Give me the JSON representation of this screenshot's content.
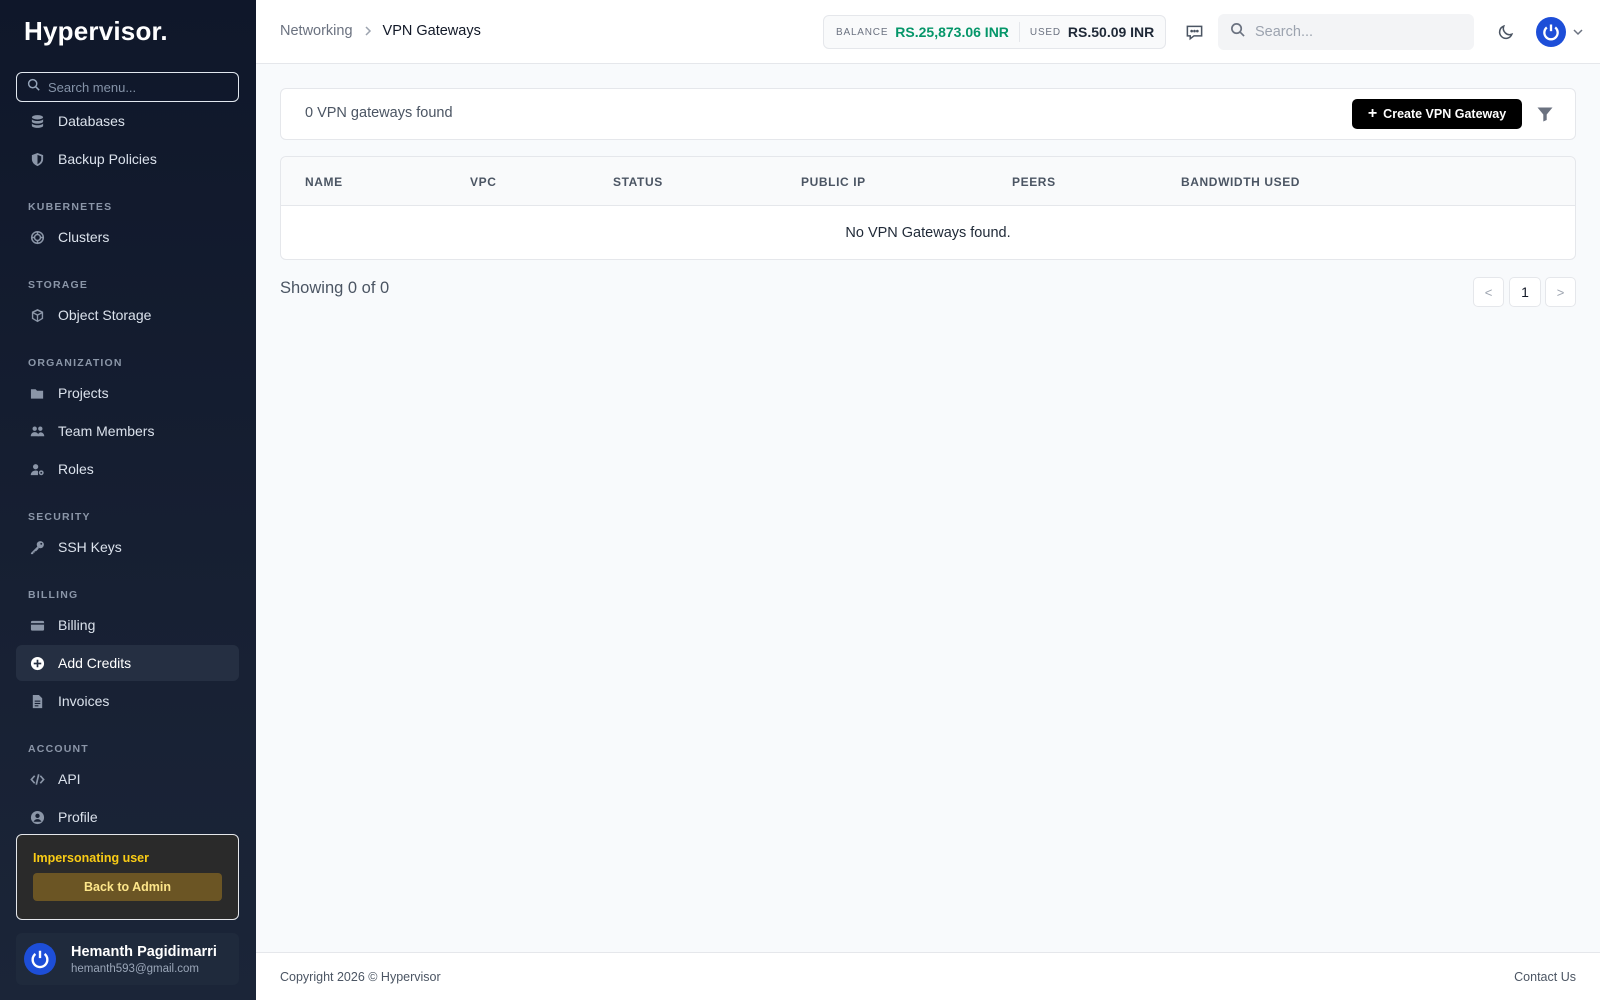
{
  "brand": "Hypervisor.",
  "sidebar": {
    "search_placeholder": "Search menu...",
    "items_top": [
      {
        "label": "Databases",
        "icon": "database-icon"
      },
      {
        "label": "Backup Policies",
        "icon": "shield-icon"
      }
    ],
    "sections": [
      {
        "title": "KUBERNETES",
        "items": [
          {
            "label": "Clusters",
            "icon": "helm-icon"
          }
        ]
      },
      {
        "title": "STORAGE",
        "items": [
          {
            "label": "Object Storage",
            "icon": "cube-icon"
          }
        ]
      },
      {
        "title": "ORGANIZATION",
        "items": [
          {
            "label": "Projects",
            "icon": "folder-icon"
          },
          {
            "label": "Team Members",
            "icon": "users-icon"
          },
          {
            "label": "Roles",
            "icon": "user-gear-icon"
          }
        ]
      },
      {
        "title": "SECURITY",
        "items": [
          {
            "label": "SSH Keys",
            "icon": "key-icon"
          }
        ]
      },
      {
        "title": "BILLING",
        "items": [
          {
            "label": "Billing",
            "icon": "wallet-icon"
          },
          {
            "label": "Add Credits",
            "icon": "plus-circle-icon"
          },
          {
            "label": "Invoices",
            "icon": "file-icon"
          }
        ]
      },
      {
        "title": "ACCOUNT",
        "items": [
          {
            "label": "API",
            "icon": "code-icon"
          },
          {
            "label": "Profile",
            "icon": "user-circle-icon"
          }
        ]
      }
    ],
    "active_item": "Add Credits",
    "impersonation": {
      "label": "Impersonating user",
      "button": "Back to Admin"
    },
    "user": {
      "name": "Hemanth Pagidimarri",
      "email": "hemanth593@gmail.com"
    }
  },
  "header": {
    "breadcrumb": {
      "parent": "Networking",
      "current": "VPN Gateways"
    },
    "balance_label": "BALANCE",
    "balance_value": "RS.25,873.06 INR",
    "used_label": "USED",
    "used_value": "RS.50.09 INR",
    "search_placeholder": "Search..."
  },
  "main": {
    "count_text": "0 VPN gateways found",
    "create_button": "Create VPN Gateway",
    "columns": [
      "NAME",
      "VPC",
      "STATUS",
      "PUBLIC IP",
      "PEERS",
      "BANDWIDTH USED"
    ],
    "empty_message": "No VPN Gateways found.",
    "showing": "Showing 0 of 0",
    "pagination": {
      "prev": "<",
      "page": "1",
      "next": ">"
    }
  },
  "footer": {
    "copyright": "Copyright 2026 © Hypervisor",
    "contact": "Contact Us"
  },
  "colors": {
    "sidebar_bg": "#0f172a",
    "balance_green": "#059669",
    "primary_button": "#000000",
    "avatar_blue": "#1d4ed8",
    "impersonate_text": "#facc15"
  }
}
